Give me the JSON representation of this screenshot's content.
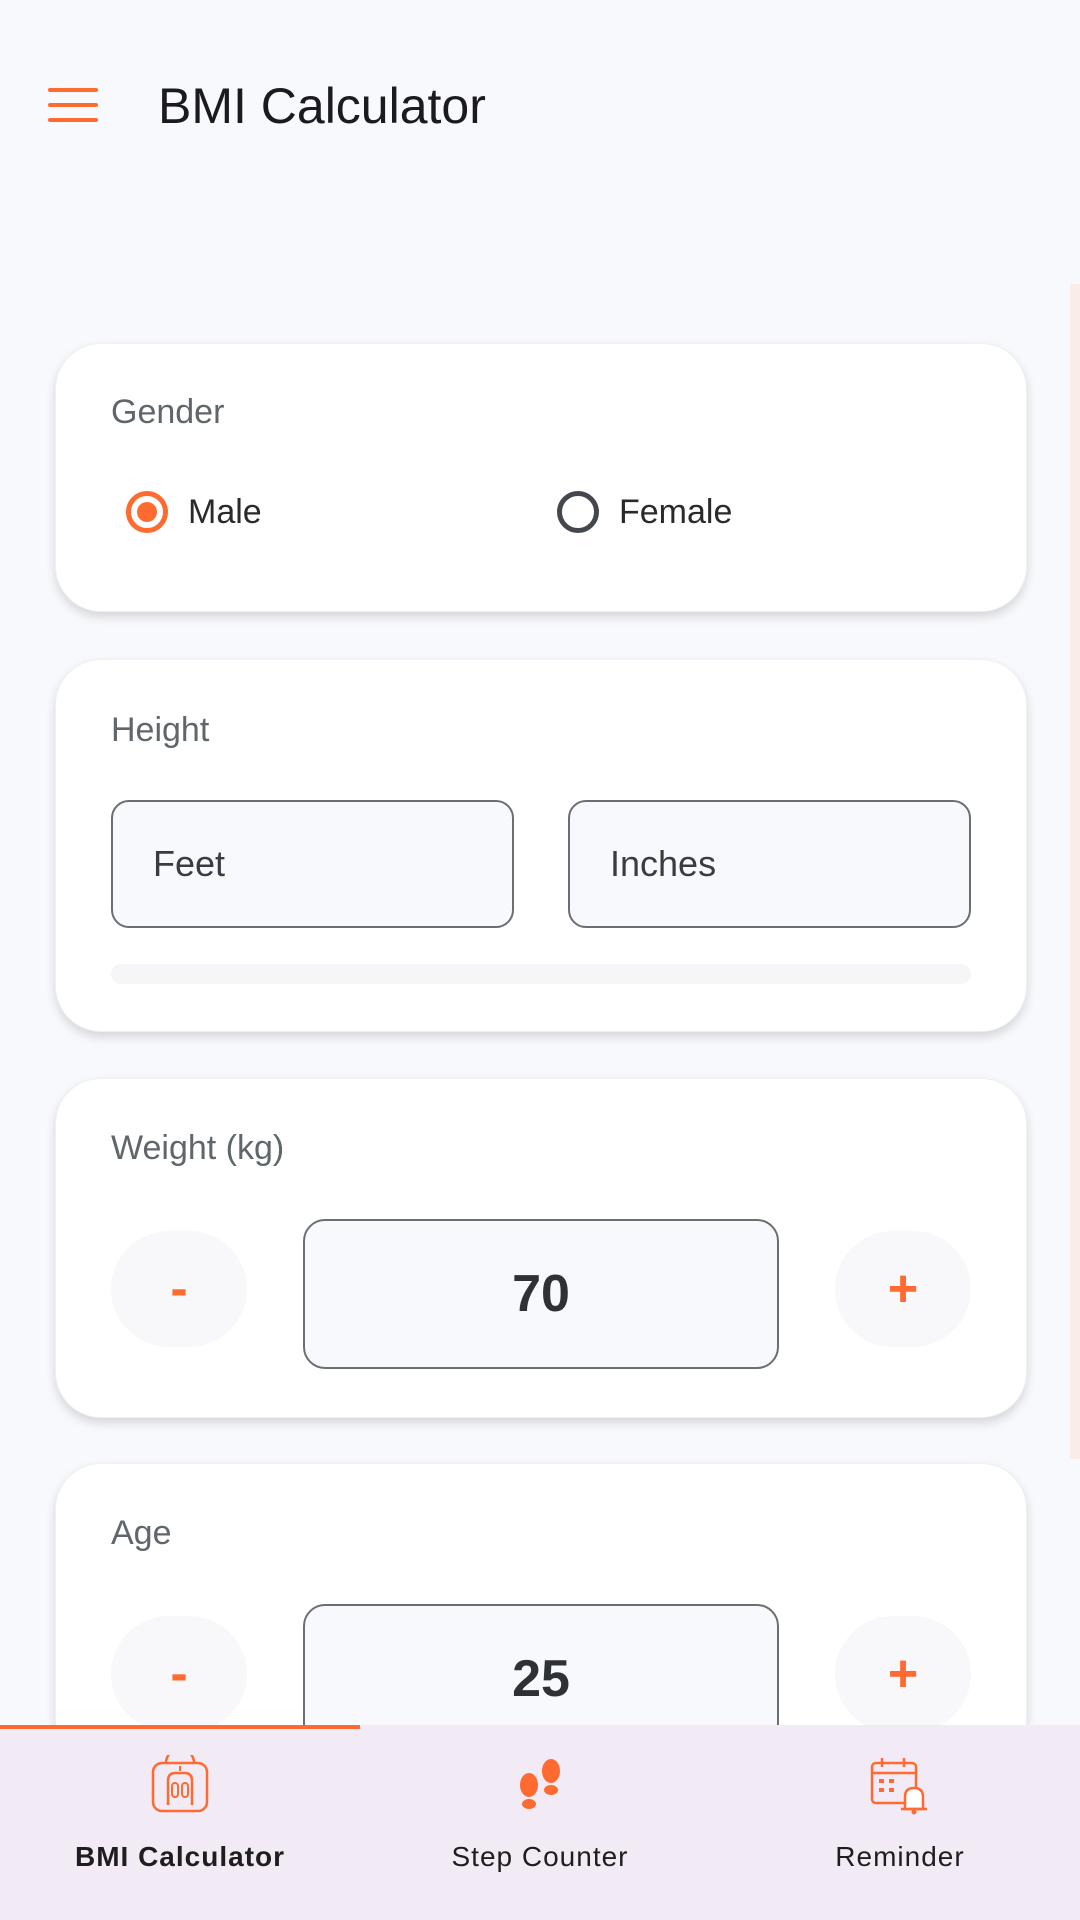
{
  "appbar": {
    "title": "BMI Calculator"
  },
  "colors": {
    "accent": "#ff6a30",
    "nav_background": "#f2ebf6",
    "card": "#ffffff"
  },
  "gender": {
    "label": "Gender",
    "options": [
      {
        "label": "Male",
        "selected": true
      },
      {
        "label": "Female",
        "selected": false
      }
    ]
  },
  "height": {
    "label": "Height",
    "feet_placeholder": "Feet",
    "inches_placeholder": "Inches"
  },
  "weight": {
    "label": "Weight (kg)",
    "value": "70",
    "decrement": "-",
    "increment": "+"
  },
  "age": {
    "label": "Age",
    "value": "25",
    "decrement": "-",
    "increment": "+"
  },
  "nav": {
    "items": [
      {
        "label": "BMI Calculator",
        "icon": "scale-icon",
        "active": true
      },
      {
        "label": "Step Counter",
        "icon": "footsteps-icon",
        "active": false
      },
      {
        "label": "Reminder",
        "icon": "calendar-bell-icon",
        "active": false
      }
    ]
  }
}
